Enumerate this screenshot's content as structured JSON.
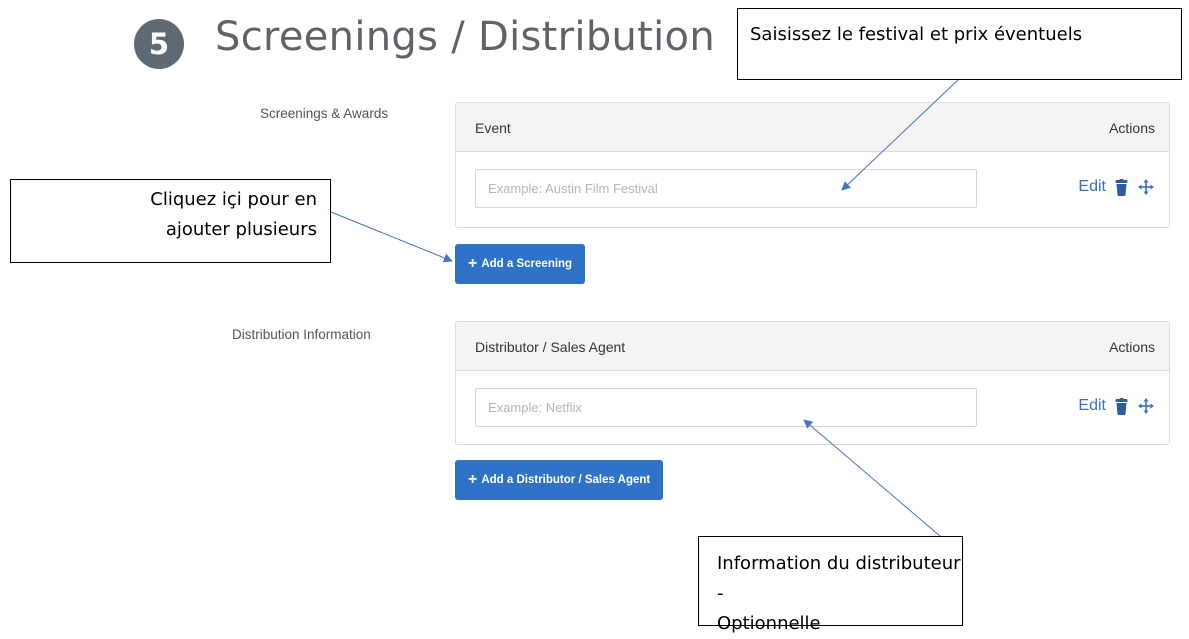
{
  "header": {
    "step_number": "5",
    "title": "Screenings / Distribution"
  },
  "screenings": {
    "label": "Screenings & Awards",
    "column_left": "Event",
    "column_right": "Actions",
    "input_placeholder": "Example: Austin Film Festival",
    "edit_label": "Edit",
    "add_button_label": "Add a Screening",
    "add_button_icon": "+"
  },
  "distribution": {
    "label": "Distribution Information",
    "column_left": "Distributor / Sales Agent",
    "column_right": "Actions",
    "input_placeholder": "Example: Netflix",
    "edit_label": "Edit",
    "add_button_label": "Add a Distributor / Sales Agent",
    "add_button_icon": "+"
  },
  "callouts": {
    "festival": "Saisissez le festival et prix éventuels",
    "add_multiple_line1": "Cliquez içi pour en",
    "add_multiple_line2": "ajouter plusieurs",
    "distributor_line1": "Information du distributeur -",
    "distributor_line2": "Optionnelle"
  },
  "colors": {
    "badge": "#5f6a75",
    "button": "#2f73c8",
    "link": "#3a6fc4",
    "arrow": "#4472c4",
    "icon": "#2d5d9f"
  },
  "icons": {
    "delete": "trash-icon",
    "reorder": "move-icon"
  }
}
